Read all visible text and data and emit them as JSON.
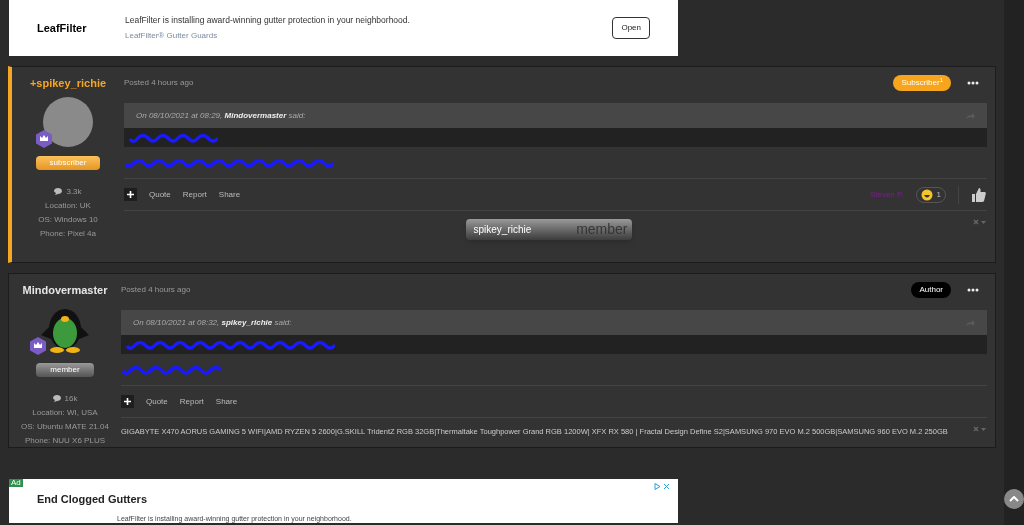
{
  "top_ad": {
    "logo": "LeafFilter",
    "headline": "LeafFilter is installing award-winning gutter protection in your neighborhood.",
    "advertiser": "LeafFilter® Gutter Guards",
    "button": "Open"
  },
  "posts": [
    {
      "author": "+spikey_richie",
      "highlighted": true,
      "avatar": {
        "kind": "photo"
      },
      "rank": "subscriber",
      "posts": "3.3k",
      "info": [
        "Location: UK",
        "OS: Windows 10",
        "Phone: Pixel 4a"
      ],
      "time": "Posted 4 hours ago",
      "badge": {
        "text": "Subscriber",
        "sup": "1",
        "kind": "gold"
      },
      "quote": {
        "date": "On 08/10/2021 at 08:29,",
        "author": "Mindovermaster",
        "said": "said:"
      },
      "actions": [
        "Quote",
        "Report",
        "Share"
      ],
      "reaction": {
        "user": "Steven P.",
        "count": "1"
      },
      "signature": {
        "kind": "userbar",
        "name": "spikey_richie",
        "watermark": "member"
      }
    },
    {
      "author": "Mindovermaster",
      "highlighted": false,
      "avatar": {
        "kind": "penguin"
      },
      "rank": "member",
      "posts": "16k",
      "info": [
        "Location: WI, USA",
        "OS: Ubuntu MATE 21.04",
        "Phone: NUU X6 PLUS"
      ],
      "time": "Posted 4 hours ago",
      "badge": {
        "text": "Author",
        "kind": "black"
      },
      "quote": {
        "date": "On 08/10/2021 at 08:32,",
        "author": "spikey_richie",
        "said": "said:"
      },
      "actions": [
        "Quote",
        "Report",
        "Share"
      ],
      "signature": {
        "kind": "text",
        "text": "GIGABYTE X470 AORUS GAMING 5 WIFI|AMD RYZEN 5 2600|G.SKILL TridentZ RGB 32GB|Thermaltake Toughpower Grand RGB 1200W| XFX RX 580 | Fractal Design Define S2|SAMSUNG 970 EVO M.2 500GB|SAMSUNG 960 EVO M.2 250GB"
      }
    }
  ],
  "bottom_ad": {
    "label": "Ad",
    "title": "End Clogged Gutters",
    "text": "LeafFilter is installing award-winning gutter protection in your neighborhood."
  }
}
